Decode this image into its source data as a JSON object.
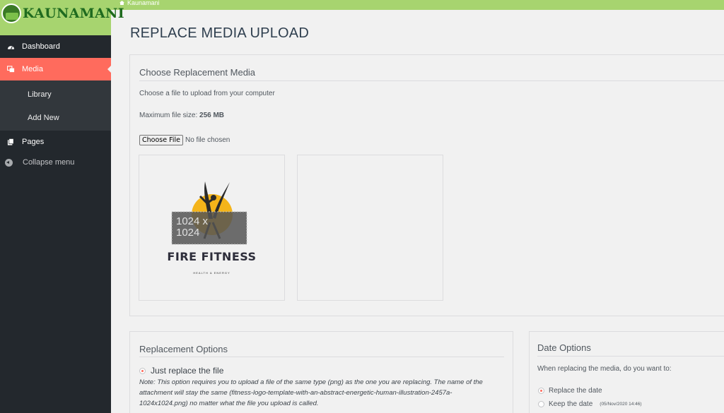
{
  "adminbar": {
    "site_name": "Kaunamani"
  },
  "sidebar": {
    "logo_text": "KAUNAMANI",
    "items": [
      {
        "label": "Dashboard",
        "icon": "dashboard-icon"
      },
      {
        "label": "Media",
        "icon": "media-icon",
        "active": true
      },
      {
        "label": "Pages",
        "icon": "pages-icon"
      }
    ],
    "media_submenu": [
      "Library",
      "Add New"
    ],
    "collapse_label": "Collapse menu"
  },
  "page_title": "REPLACE MEDIA UPLOAD",
  "upload_panel": {
    "heading": "Choose Replacement Media",
    "instruction": "Choose a file to upload from your computer",
    "max_size_label": "Maximum file size: ",
    "max_size_value": "256 MB",
    "choose_button": "Choose File",
    "file_status": "No file chosen",
    "current_preview": {
      "dimensions_line1": "1024 x",
      "dimensions_line2": "1024",
      "logo_title": "FIRE FITNESS",
      "logo_tagline": "HEALTH & ENERGY"
    }
  },
  "replacement_options": {
    "heading": "Replacement Options",
    "option_label": "Just replace the file",
    "note": "Note: This option requires you to upload a file of the same type (png) as the one you are replacing. The name of the attachment will stay the same (fitness-logo-template-with-an-abstract-energetic-human-illustration-2457a-1024x1024.png) no matter what the file you upload is called."
  },
  "date_options": {
    "heading": "Date Options",
    "question": "When replacing the media, do you want to:",
    "options": [
      {
        "label": "Replace the date",
        "checked": true
      },
      {
        "label": "Keep the date",
        "checked": false,
        "detail": "(05/Nov/2020 14:46)"
      }
    ]
  },
  "colors": {
    "accent": "#ff6b5d",
    "brand_green": "#a7d46f",
    "sidebar_bg": "#23282d"
  }
}
